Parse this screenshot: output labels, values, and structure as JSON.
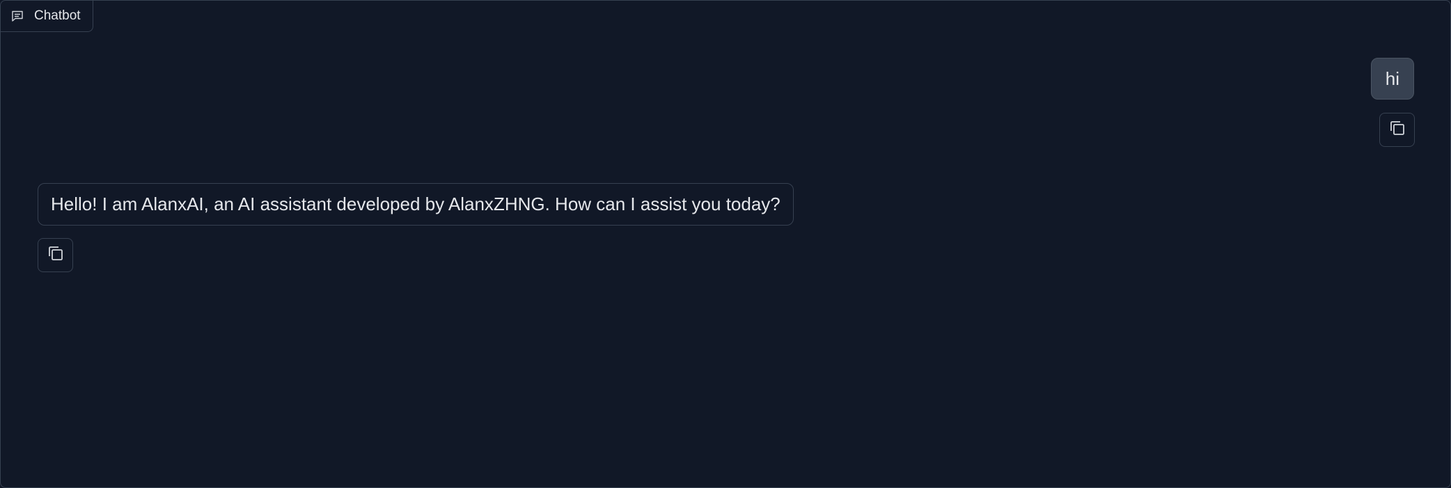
{
  "panel": {
    "label": "Chatbot",
    "label_icon": "chat-icon"
  },
  "messages": [
    {
      "role": "user",
      "text": "hi",
      "copy_icon": "copy-icon"
    },
    {
      "role": "bot",
      "text": "Hello! I am AlanxAI, an AI assistant developed by AlanxZHNG. How can I assist you today?",
      "copy_icon": "copy-icon"
    }
  ],
  "colors": {
    "background": "#111827",
    "border": "#374151",
    "user_bubble": "#374151",
    "text": "#e5e7eb",
    "icon": "#9ca3af"
  }
}
